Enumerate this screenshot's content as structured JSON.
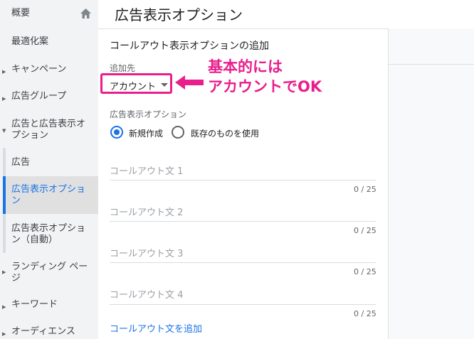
{
  "sidebar": {
    "items": [
      {
        "label": "概要"
      },
      {
        "label": "最適化案"
      },
      {
        "label": "キャンペーン"
      },
      {
        "label": "広告グループ"
      },
      {
        "label": "広告と広告表示オ",
        "label2": "プション"
      },
      {
        "label": "広告"
      },
      {
        "label": "広告表示オプショ",
        "label2": "ン"
      },
      {
        "label": "広告表示オプショ",
        "label2": "ン（自動）"
      },
      {
        "label": "ランディング ペー",
        "label2": "ジ"
      },
      {
        "label": "キーワード"
      },
      {
        "label": "オーディエンス"
      }
    ]
  },
  "header": {
    "title": "広告表示オプション"
  },
  "form": {
    "title": "コールアウト表示オプションの追加",
    "dest_label": "追加先",
    "dest_value": "アカウント",
    "ext_label": "広告表示オプション",
    "radio_new": "新規作成",
    "radio_existing": "既存のものを使用",
    "fields": [
      {
        "placeholder": "コールアウト文 1",
        "count": "0 / 25"
      },
      {
        "placeholder": "コールアウト文 2",
        "count": "0 / 25"
      },
      {
        "placeholder": "コールアウト文 3",
        "count": "0 / 25"
      },
      {
        "placeholder": "コールアウト文 4",
        "count": "0 / 25"
      }
    ],
    "add_link": "コールアウト文を追加"
  },
  "annotation": {
    "line1": "基本的には",
    "line2": "アカウントでOK"
  },
  "colors": {
    "accent": "#1a73e8",
    "annotation": "#e91e8c"
  },
  "icons": {
    "home": "home-icon",
    "expand": "chevron-right-icon",
    "dropdown": "caret-down-icon"
  }
}
